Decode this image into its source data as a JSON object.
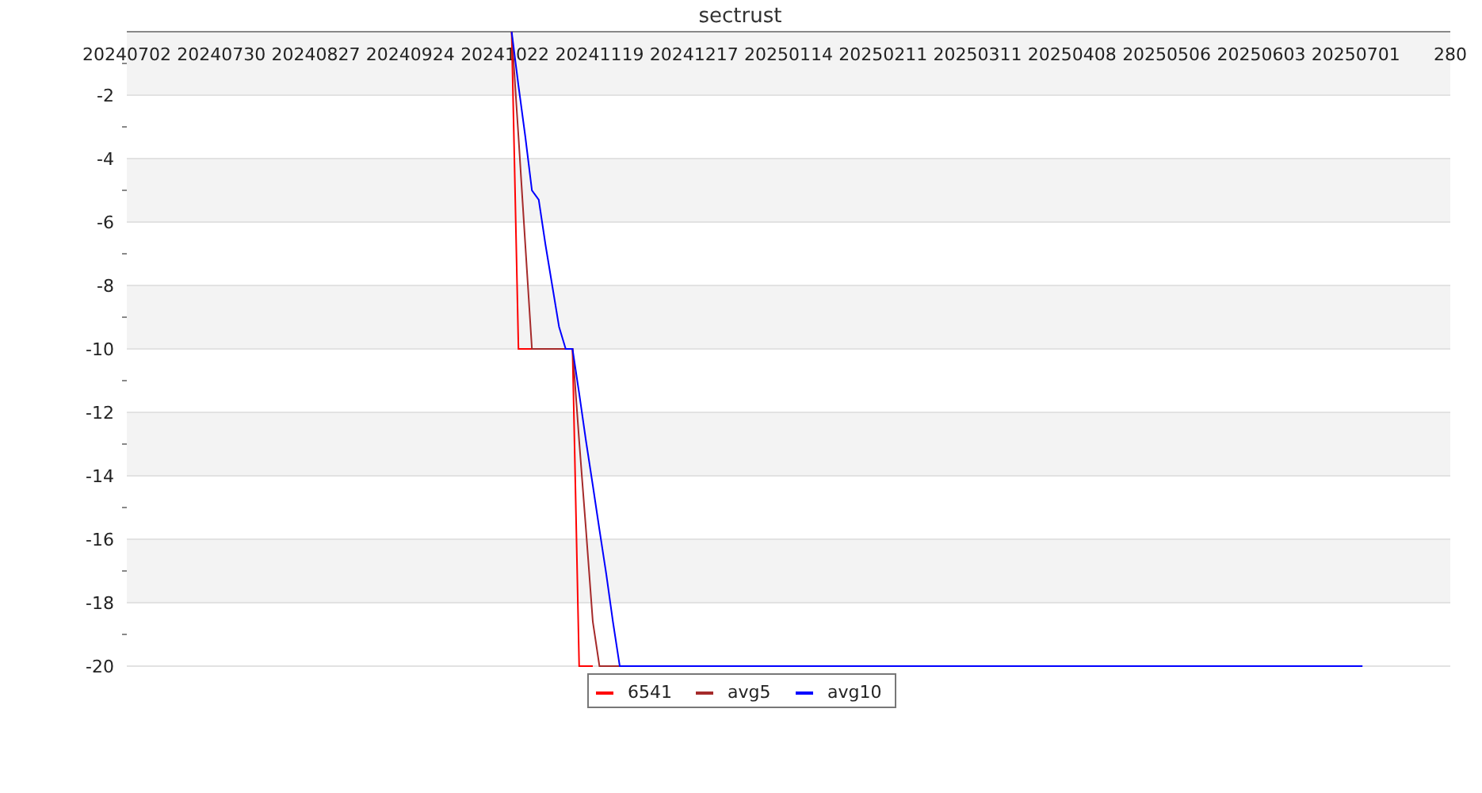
{
  "chart": {
    "chart_data": {
      "type": "line",
      "title": "sectrust",
      "grid": true,
      "legend": true,
      "categories": [
        "20240702",
        null,
        null,
        null,
        null,
        null,
        null,
        null,
        null,
        null,
        null,
        null,
        null,
        null,
        "20240730",
        null,
        null,
        null,
        null,
        null,
        null,
        null,
        null,
        null,
        null,
        null,
        null,
        null,
        "20240827",
        null,
        null,
        null,
        null,
        null,
        null,
        null,
        null,
        null,
        null,
        null,
        null,
        null,
        "20240924",
        null,
        null,
        null,
        null,
        null,
        null,
        null,
        null,
        null,
        null,
        null,
        null,
        null,
        "20241022",
        null,
        null,
        null,
        null,
        null,
        null,
        null,
        null,
        null,
        null,
        null,
        null,
        null,
        "20241119",
        null,
        null,
        null,
        null,
        null,
        null,
        null,
        null,
        null,
        null,
        null,
        null,
        null,
        "20241217",
        null,
        null,
        null,
        null,
        null,
        null,
        null,
        null,
        null,
        null,
        null,
        null,
        null,
        "20250114",
        null,
        null,
        null,
        null,
        null,
        null,
        null,
        null,
        null,
        null,
        null,
        null,
        null,
        "20250211",
        null,
        null,
        null,
        null,
        null,
        null,
        null,
        null,
        null,
        null,
        null,
        null,
        null,
        "20250311",
        null,
        null,
        null,
        null,
        null,
        null,
        null,
        null,
        null,
        null,
        null,
        null,
        null,
        "20250408",
        null,
        null,
        null,
        null,
        null,
        null,
        null,
        null,
        null,
        null,
        null,
        null,
        null,
        "20250506",
        null,
        null,
        null,
        null,
        null,
        null,
        null,
        null,
        null,
        null,
        null,
        null,
        null,
        "20250603",
        null,
        null,
        null,
        null,
        null,
        null,
        null,
        null,
        null,
        null,
        null,
        null,
        null,
        "20250701",
        null,
        null,
        null,
        null,
        null,
        null,
        null,
        null,
        null,
        null,
        null,
        null,
        null,
        "280"
      ],
      "series": [
        {
          "name": "6541",
          "color": "#ff0000",
          "values": [
            null,
            null,
            null,
            null,
            null,
            null,
            null,
            null,
            null,
            null,
            null,
            null,
            null,
            null,
            null,
            null,
            null,
            null,
            null,
            null,
            null,
            null,
            null,
            null,
            null,
            null,
            null,
            null,
            null,
            null,
            null,
            null,
            null,
            null,
            null,
            null,
            null,
            null,
            null,
            null,
            null,
            null,
            null,
            null,
            null,
            null,
            null,
            null,
            null,
            null,
            null,
            null,
            null,
            null,
            null,
            null,
            null,
            0,
            -10,
            -10,
            -10,
            -10,
            -10,
            -10,
            -10,
            -10,
            -10,
            -20,
            -20,
            -20,
            null,
            null,
            null,
            null,
            null,
            null,
            null,
            null,
            null,
            null,
            null,
            null,
            null,
            null,
            null,
            null,
            null,
            null,
            null,
            null,
            null,
            null,
            null,
            null,
            null,
            null,
            null,
            null,
            null,
            null,
            null,
            null,
            null,
            null,
            null,
            null,
            null,
            null,
            null,
            null,
            null,
            null,
            null,
            null,
            null,
            null,
            null,
            null,
            null,
            null,
            null,
            null,
            null,
            null,
            null,
            null,
            null,
            null,
            null,
            null,
            null,
            null,
            null,
            null,
            null,
            null,
            null,
            null,
            null,
            null,
            null,
            null,
            null,
            null,
            null,
            null,
            null,
            null,
            null,
            null,
            null,
            null,
            null,
            null,
            null,
            null,
            null,
            null,
            null,
            null,
            null,
            null,
            null,
            null,
            null,
            null,
            null,
            null,
            null,
            null,
            null,
            null,
            null,
            null,
            null,
            null,
            null,
            null,
            null,
            null,
            null,
            null,
            null,
            null,
            null,
            null,
            null,
            null,
            null,
            null,
            null,
            null,
            null,
            null,
            null,
            null,
            null
          ]
        },
        {
          "name": "avg5",
          "color": "#a52a2a",
          "values": [
            null,
            null,
            null,
            null,
            null,
            null,
            null,
            null,
            null,
            null,
            null,
            null,
            null,
            null,
            null,
            null,
            null,
            null,
            null,
            null,
            null,
            null,
            null,
            null,
            null,
            null,
            null,
            null,
            null,
            null,
            null,
            null,
            null,
            null,
            null,
            null,
            null,
            null,
            null,
            null,
            null,
            null,
            null,
            null,
            null,
            null,
            null,
            null,
            null,
            null,
            null,
            null,
            null,
            null,
            null,
            null,
            null,
            0,
            -3.3,
            -6.7,
            -10,
            -10,
            -10,
            -10,
            -10,
            -10,
            -10,
            -12.9,
            -15.7,
            -18.6,
            -20,
            -20,
            -20,
            -20,
            null,
            null,
            null,
            null,
            null,
            null,
            null,
            null,
            null,
            null,
            null,
            null,
            null,
            null,
            null,
            null,
            null,
            null,
            null,
            null,
            null,
            null,
            null,
            null,
            null,
            null,
            null,
            null,
            null,
            null,
            null,
            null,
            null,
            null,
            null,
            null,
            null,
            null,
            null,
            null,
            null,
            null,
            null,
            null,
            null,
            null,
            null,
            null,
            null,
            null,
            null,
            null,
            null,
            null,
            null,
            null,
            null,
            null,
            null,
            null,
            null,
            null,
            null,
            null,
            null,
            null,
            null,
            null,
            null,
            null,
            null,
            null,
            null,
            null,
            null,
            null,
            null,
            null,
            null,
            null,
            null,
            null,
            null,
            null,
            null,
            null,
            null,
            null,
            null,
            null,
            null,
            null,
            null,
            null,
            null,
            null,
            null,
            null,
            null,
            null,
            null,
            null,
            null,
            null,
            null,
            null,
            null,
            null,
            null,
            null,
            null,
            null,
            null,
            null,
            null,
            null,
            null,
            null,
            null,
            null,
            null,
            null,
            null
          ]
        },
        {
          "name": "avg10",
          "color": "#0000ff",
          "values": [
            null,
            null,
            null,
            null,
            null,
            null,
            null,
            null,
            null,
            null,
            null,
            null,
            null,
            null,
            null,
            null,
            null,
            null,
            null,
            null,
            null,
            null,
            null,
            null,
            null,
            null,
            null,
            null,
            null,
            null,
            null,
            null,
            null,
            null,
            null,
            null,
            null,
            null,
            null,
            null,
            null,
            null,
            null,
            null,
            null,
            null,
            null,
            null,
            null,
            null,
            null,
            null,
            null,
            null,
            null,
            null,
            null,
            0,
            -1.7,
            -3.3,
            -5,
            -5.3,
            -6.7,
            -8,
            -9.3,
            -10,
            -10,
            -11.4,
            -12.9,
            -14.3,
            -15.7,
            -17.1,
            -18.6,
            -20,
            -20,
            -20,
            -20,
            -20,
            -20,
            -20,
            -20,
            -20,
            -20,
            -20,
            -20,
            -20,
            -20,
            -20,
            -20,
            -20,
            -20,
            -20,
            -20,
            -20,
            -20,
            -20,
            -20,
            -20,
            -20,
            -20,
            -20,
            -20,
            -20,
            -20,
            -20,
            -20,
            -20,
            -20,
            -20,
            -20,
            -20,
            -20,
            -20,
            -20,
            -20,
            -20,
            -20,
            -20,
            -20,
            -20,
            -20,
            -20,
            -20,
            -20,
            -20,
            -20,
            -20,
            -20,
            -20,
            -20,
            -20,
            -20,
            -20,
            -20,
            -20,
            -20,
            -20,
            -20,
            -20,
            -20,
            -20,
            -20,
            -20,
            -20,
            -20,
            -20,
            -20,
            -20,
            -20,
            -20,
            -20,
            -20,
            -20,
            -20,
            -20,
            -20,
            -20,
            -20,
            -20,
            -20,
            -20,
            -20,
            -20,
            -20,
            -20,
            -20,
            -20,
            -20,
            -20,
            -20,
            -20,
            -20,
            -20,
            -20,
            -20,
            -20,
            -20,
            -20,
            -20,
            -20,
            -20,
            -20,
            -20,
            -20,
            null,
            null,
            null,
            null,
            null,
            null,
            null,
            null,
            null,
            null,
            null,
            null,
            null
          ]
        }
      ],
      "ylim": [
        -20,
        0
      ],
      "yticks": [
        -2,
        -4,
        -6,
        -8,
        -10,
        -12,
        -14,
        -16,
        -18,
        -20
      ]
    }
  }
}
